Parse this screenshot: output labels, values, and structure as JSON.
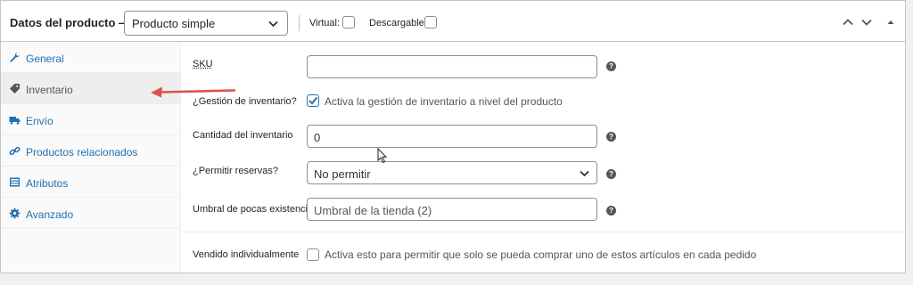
{
  "header": {
    "title": "Datos del producto —",
    "product_type": "Producto simple",
    "virtual_label": "Virtual:",
    "virtual_checked": false,
    "downloadable_label": "Descargable:",
    "downloadable_checked": false
  },
  "sidebar": {
    "items": [
      {
        "label": "General",
        "icon": "wrench-icon",
        "active": false
      },
      {
        "label": "Inventario",
        "icon": "tag-icon",
        "active": true
      },
      {
        "label": "Envío",
        "icon": "truck-icon",
        "active": false
      },
      {
        "label": "Productos relacionados",
        "icon": "link-icon",
        "active": false
      },
      {
        "label": "Atributos",
        "icon": "table-icon",
        "active": false
      },
      {
        "label": "Avanzado",
        "icon": "gear-icon",
        "active": false
      }
    ]
  },
  "form": {
    "sku": {
      "label": "SKU",
      "value": ""
    },
    "manage_stock": {
      "label": "¿Gestión de inventario?",
      "checked": true,
      "description": "Activa la gestión de inventario a nivel del producto"
    },
    "stock_qty": {
      "label": "Cantidad del inventario",
      "value": "0"
    },
    "backorders": {
      "label": "¿Permitir reservas?",
      "value": "No permitir"
    },
    "low_stock": {
      "label": "Umbral de pocas existencias",
      "placeholder": "Umbral de la tienda (2)"
    },
    "sold_individually": {
      "label": "Vendido individualmente",
      "checked": false,
      "description": "Activa esto para permitir que solo se pueda comprar uno de estos artículos en cada pedido"
    }
  },
  "colors": {
    "accent": "#2271b1",
    "annotation_arrow": "#d9534f"
  }
}
